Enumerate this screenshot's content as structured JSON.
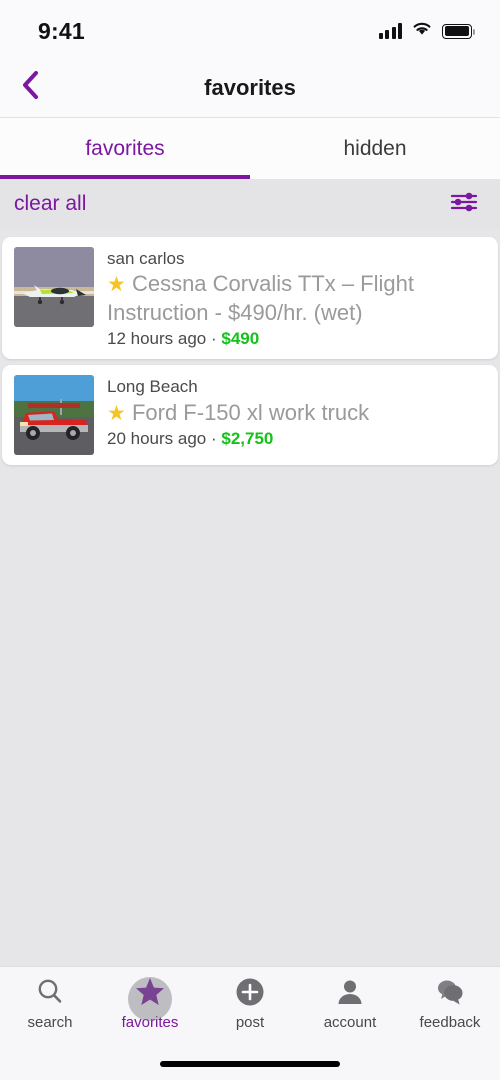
{
  "status_bar": {
    "time": "9:41",
    "signal_icon": "cellular-signal-icon",
    "wifi_icon": "wifi-icon",
    "battery_icon": "battery-full-icon"
  },
  "header": {
    "back_icon": "chevron-left-icon",
    "title": "favorites"
  },
  "tabs": [
    {
      "label": "favorites",
      "active": true
    },
    {
      "label": "hidden",
      "active": false
    }
  ],
  "toolbar": {
    "clear_all_label": "clear all",
    "filter_icon": "sliders-filter-icon"
  },
  "listings": [
    {
      "location": "san carlos",
      "star": "★",
      "title": "Cessna Corvalis TTx – Flight Instruction - $490/hr. (wet)",
      "posted": "12 hours ago",
      "separator": "·",
      "price": "$490",
      "thumbnail": "green-white-airplane-on-tarmac"
    },
    {
      "location": "Long Beach",
      "star": "★",
      "title": "Ford F-150 xl work truck",
      "posted": "20 hours ago",
      "separator": "·",
      "price": "$2,750",
      "thumbnail": "red-pickup-truck"
    }
  ],
  "bottom_nav": [
    {
      "label": "search",
      "icon": "magnifier-icon",
      "active": false
    },
    {
      "label": "favorites",
      "icon": "star-icon",
      "active": true
    },
    {
      "label": "post",
      "icon": "plus-circle-icon",
      "active": false
    },
    {
      "label": "account",
      "icon": "person-icon",
      "active": false
    },
    {
      "label": "feedback",
      "icon": "speech-bubbles-icon",
      "active": false
    }
  ],
  "colors": {
    "accent_purple": "#7b189f",
    "price_green": "#14c21a",
    "star_gold": "#f7c325",
    "page_background": "#e6e5e8"
  }
}
